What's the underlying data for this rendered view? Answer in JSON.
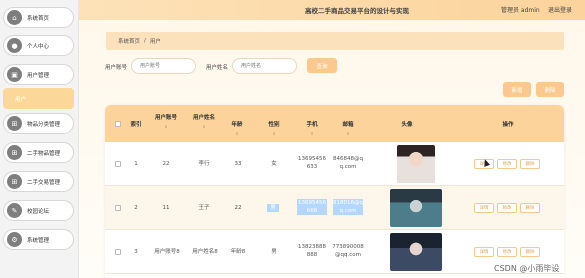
{
  "header": {
    "title": "高校二手商品交易平台的设计与实现",
    "user": "管理员 admin",
    "logout": "退出登录"
  },
  "sidebar": {
    "items": [
      {
        "label": "系统首页",
        "icon": "home-icon"
      },
      {
        "label": "个人中心",
        "icon": "person-icon"
      },
      {
        "label": "用户管理",
        "icon": "users-icon"
      },
      {
        "label": "用户",
        "icon": ""
      },
      {
        "label": "物品分类管理",
        "icon": "grid-icon"
      },
      {
        "label": "二手物品管理",
        "icon": "grid-icon"
      },
      {
        "label": "二手交易管理",
        "icon": "grid-icon"
      },
      {
        "label": "校园论坛",
        "icon": "forum-icon"
      },
      {
        "label": "系统管理",
        "icon": "settings-icon"
      }
    ]
  },
  "breadcrumb": {
    "home": "系统首页",
    "sep": "/",
    "current": "用户"
  },
  "search": {
    "account_label": "用户账号",
    "account_placeholder": "用户账号",
    "name_label": "用户姓名",
    "name_placeholder": "用户姓名",
    "button": "查询"
  },
  "actions": {
    "add": "新增",
    "delete": "删除"
  },
  "table": {
    "headers": {
      "index": "索引",
      "account": "用户账号",
      "name": "用户姓名",
      "age": "年龄",
      "gender": "性别",
      "phone": "手机",
      "email": "邮箱",
      "avatar": "头像",
      "ops": "操作"
    },
    "sort_glyph": "⇕",
    "rows": [
      {
        "index": "1",
        "account": "22",
        "name": "李行",
        "age": "33",
        "gender": "女",
        "phone": "13695456633",
        "email": "846848@qq.com"
      },
      {
        "index": "2",
        "account": "11",
        "name": "王子",
        "age": "22",
        "gender": "男",
        "phone": "13695456666",
        "email": "818016@qq.com"
      },
      {
        "index": "3",
        "account": "用户账号8",
        "name": "用户姓名8",
        "age": "年龄8",
        "gender": "男",
        "phone": "13823888888",
        "email": "773890008@qq.com"
      }
    ],
    "row_buttons": {
      "detail": "详情",
      "edit": "修改",
      "delete": "删除"
    }
  },
  "watermark": "CSDN @小雨毕设",
  "colors": {
    "accent": "#fbc98e",
    "header": "#fcd39b",
    "sidebar_active": "#fbd89a",
    "selection": "#b3d7ff"
  }
}
